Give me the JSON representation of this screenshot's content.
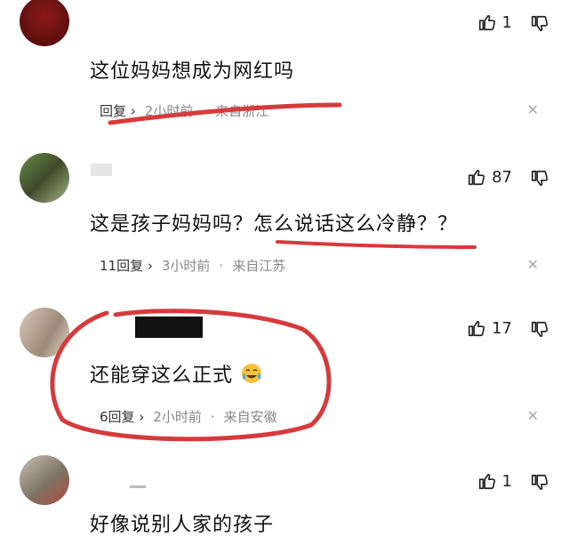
{
  "comments": [
    {
      "likes": "1",
      "text": "这位妈妈想成为网红吗",
      "reply_label": "回复",
      "time": "2小时前",
      "location": "来自浙江"
    },
    {
      "likes": "87",
      "text_a": "这是孩子妈妈吗？",
      "text_b": "怎么说话这么冷静？？",
      "reply_label": "11回复",
      "time": "3小时前",
      "location": "来自江苏"
    },
    {
      "likes": "17",
      "text": "还能穿这么正式",
      "reply_label": "6回复",
      "time": "2小时前",
      "location": "来自安徽"
    },
    {
      "likes": "1",
      "text": "好像说别人家的孩子"
    }
  ],
  "icons": {
    "like": "thumbs-up-icon",
    "dislike": "thumbs-down-icon",
    "chevron": "chevron-right-icon",
    "close": "close-icon",
    "emoji": "crying-laughing-emoji"
  },
  "colors": {
    "annotation_red": "#d63a3a"
  }
}
